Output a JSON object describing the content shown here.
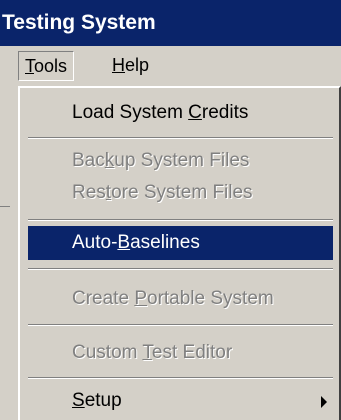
{
  "window": {
    "title": "Testing System"
  },
  "menubar": {
    "items": [
      {
        "pre": "",
        "accel": "T",
        "post": "ools"
      },
      {
        "pre": "",
        "accel": "H",
        "post": "elp"
      }
    ]
  },
  "tools_menu": {
    "items": [
      {
        "pre": "Load System ",
        "accel": "C",
        "post": "redits",
        "state": "enabled"
      },
      {
        "pre": "Bac",
        "accel": "k",
        "post": "up System Files",
        "state": "disabled"
      },
      {
        "pre": "Res",
        "accel": "t",
        "post": "ore System Files",
        "state": "disabled"
      },
      {
        "pre": "Auto-",
        "accel": "B",
        "post": "aselines",
        "state": "selected"
      },
      {
        "pre": "Create ",
        "accel": "P",
        "post": "ortable System",
        "state": "disabled"
      },
      {
        "pre": "Custom ",
        "accel": "T",
        "post": "est Editor",
        "state": "disabled"
      },
      {
        "pre": "",
        "accel": "S",
        "post": "etup",
        "state": "enabled",
        "has_submenu": true
      }
    ]
  },
  "colors": {
    "title_bar": "#0a246a",
    "menu_background": "#d4d0c8",
    "selection": "#0a246a",
    "disabled_text": "#808080"
  }
}
